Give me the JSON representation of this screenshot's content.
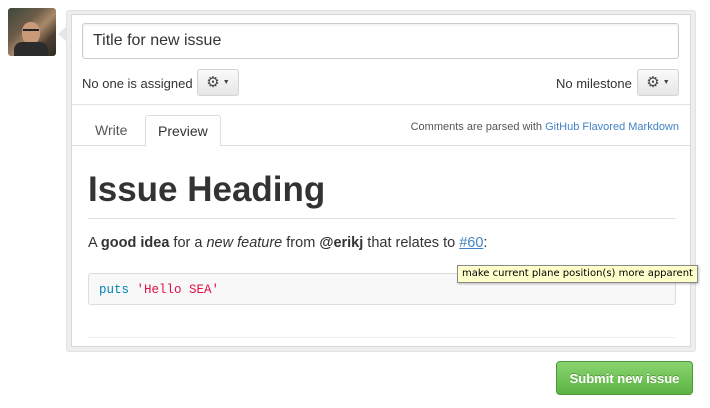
{
  "title_input": {
    "value": "Title for new issue"
  },
  "assignee": {
    "label": "No one is assigned",
    "button_icon": "gear-icon"
  },
  "milestone": {
    "label": "No milestone",
    "button_icon": "gear-icon"
  },
  "tabs": [
    {
      "label": "Write",
      "active": false
    },
    {
      "label": "Preview",
      "active": true
    }
  ],
  "comments_note": {
    "prefix": "Comments are parsed with ",
    "link": "GitHub Flavored Markdown"
  },
  "preview": {
    "heading": "Issue Heading",
    "paragraph": {
      "t1": "A ",
      "bold1": "good idea",
      "t2": " for a ",
      "italic1": "new feature",
      "t3": " from ",
      "mention": "@erikj",
      "t4": " that relates to ",
      "issue_link": "#60",
      "t5": ":"
    },
    "code": {
      "keyword": "puts",
      "string": "'Hello SEA'"
    }
  },
  "tooltip": "make current plane position(s) more apparent",
  "submit_button": {
    "label": "Submit new issue"
  },
  "colors": {
    "link": "#4183c4",
    "submit_green": "#6cc04a",
    "code_keyword": "#0086b3",
    "code_string": "#dd1144"
  }
}
